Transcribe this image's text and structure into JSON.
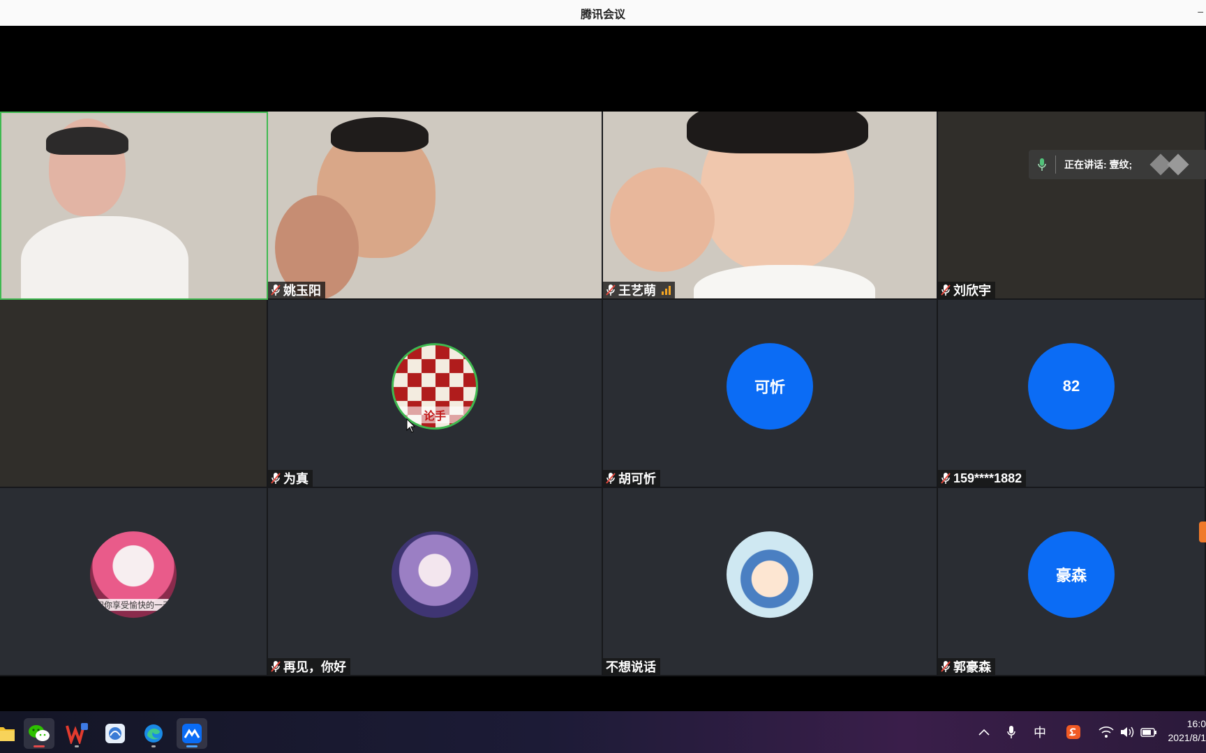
{
  "window": {
    "title": "腾讯会议",
    "min_glyph": "–"
  },
  "speaking": {
    "label": "正在讲话: 壹纹;"
  },
  "participants": [
    {
      "name": "",
      "type": "video",
      "active": true
    },
    {
      "name": "姚玉阳",
      "type": "video",
      "muted": true
    },
    {
      "name": "王艺萌",
      "type": "video",
      "muted": true,
      "signal": true
    },
    {
      "name": "刘欣宇",
      "type": "camera-off",
      "muted": true
    },
    {
      "name": "",
      "type": "camera-off"
    },
    {
      "name": "为真",
      "type": "avatar-image",
      "muted": true,
      "avatar_desc": "checker-icon",
      "avatar_caption": "论手"
    },
    {
      "name": "胡可忻",
      "type": "avatar-text",
      "muted": true,
      "avatar_text": "可忻"
    },
    {
      "name": "159****1882",
      "type": "avatar-text",
      "muted": true,
      "avatar_text": "82"
    },
    {
      "name": "",
      "type": "avatar-image",
      "avatar_desc": "cat-icon",
      "avatar_caption": "祝你享受愉快的一天"
    },
    {
      "name": "再见，你好",
      "type": "avatar-image",
      "muted": true,
      "avatar_desc": "anime-girl-icon"
    },
    {
      "name": "不想说话",
      "type": "avatar-image",
      "avatar_desc": "cartoon-boy-icon"
    },
    {
      "name": "郭豪森",
      "type": "avatar-text",
      "muted": true,
      "avatar_text": "豪森"
    }
  ],
  "taskbar": {
    "apps": [
      "folder-icon",
      "wechat-icon",
      "wps-icon",
      "app-icon",
      "edge-icon",
      "tencent-meeting-icon"
    ],
    "ime": "中",
    "time": "16:0",
    "date": "2021/8/1"
  },
  "colors": {
    "avatar_blue": "#0b6cf5",
    "active_border": "#3fb950",
    "signal": "#f5a623"
  }
}
